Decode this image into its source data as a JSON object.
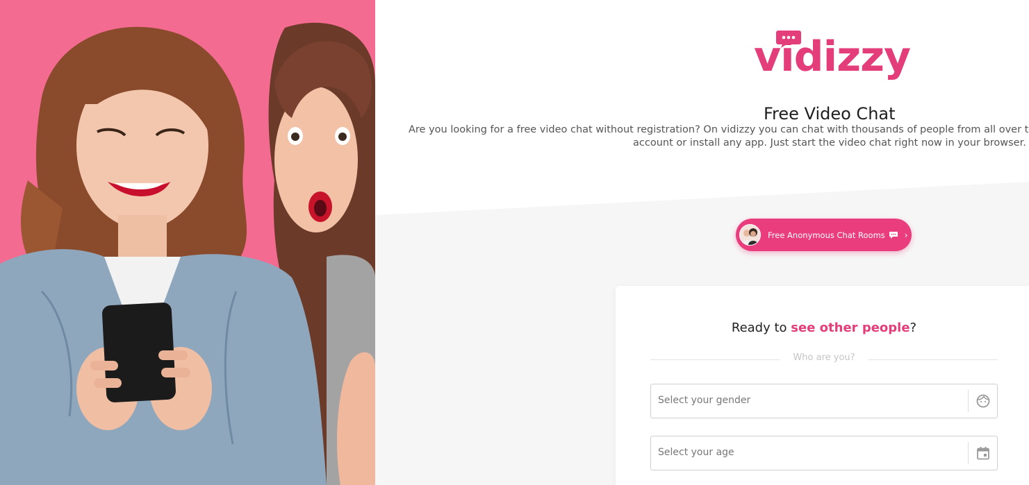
{
  "brand": {
    "logo_text": "vidizzy",
    "logo_icon": "chat-bubble-icon",
    "accent_color": "#e33d7a"
  },
  "hero": {
    "image": "two-women-looking-at-phone-photo",
    "background_color": "#f26d92"
  },
  "header": {
    "title": "Free Video Chat",
    "description_line1": "Are you looking for a free video chat without registration? On vidizzy you can chat with thousands of people from all over the w",
    "description_line2": "account or install any app. Just start the video chat right now in your browser."
  },
  "rooms_button": {
    "label": "Free Anonymous Chat Rooms",
    "icon": "chat-bubble-icon",
    "chevron": "›",
    "color": "#e93d7d"
  },
  "form": {
    "heading_prefix": "Ready to ",
    "heading_accent": "see other people",
    "heading_suffix": "?",
    "divider_label": "Who are you?",
    "gender": {
      "placeholder": "Select your gender",
      "icon": "face-icon"
    },
    "age": {
      "placeholder": "Select your age",
      "icon": "calendar-icon"
    }
  }
}
